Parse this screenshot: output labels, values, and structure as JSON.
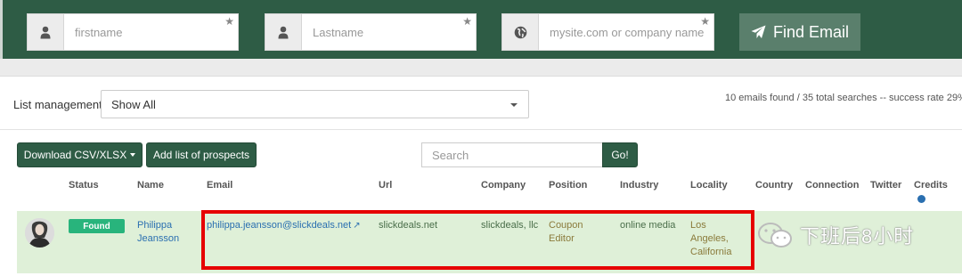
{
  "search_bar": {
    "firstname_placeholder": "firstname",
    "lastname_placeholder": "Lastname",
    "domain_placeholder": "mysite.com or company name",
    "find_label": "Find Email",
    "star": "★"
  },
  "list": {
    "label": "List management",
    "selected": "Show All",
    "stats": "10 emails found / 35 total searches -- success rate 29%"
  },
  "actions": {
    "download_label": "Download CSV/XLSX",
    "add_label": "Add list of prospects",
    "search_placeholder": "Search",
    "go_label": "Go!"
  },
  "columns": [
    "Status",
    "Name",
    "Email",
    "Url",
    "Company",
    "Position",
    "Industry",
    "Locality",
    "Country",
    "Connection",
    "Twitter",
    "Credits"
  ],
  "rows": [
    {
      "status": "Found",
      "name": "Philippa Jeansson",
      "email": "philippa.jeansson@slickdeals.net",
      "url": "slickdeals.net",
      "company": "slickdeals, llc",
      "position": "Coupon Editor",
      "industry": "online media",
      "locality": "Los Angeles, California"
    }
  ],
  "watermark": "下班后8小时",
  "colors": {
    "brand": "#2e5c45",
    "found": "#28b47c",
    "row_bg": "#dff0d8",
    "highlight": "#e60000"
  }
}
